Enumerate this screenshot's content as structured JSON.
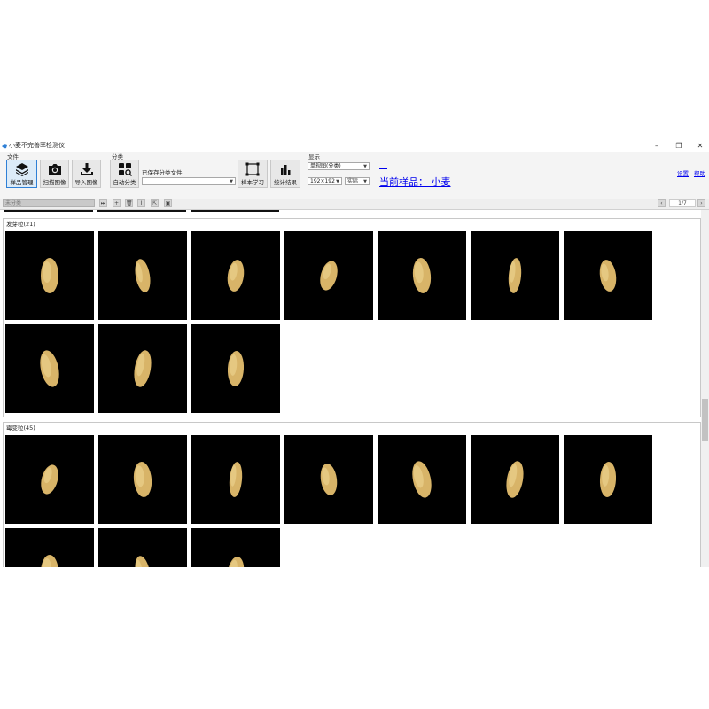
{
  "window": {
    "title": "小麦不完善率检测仪",
    "logo_icon": "app-logo-icon",
    "minimize": "–",
    "restore": "❐",
    "close": "✕"
  },
  "ribbon": {
    "file_group": "文件",
    "sample_manage": "样品管理",
    "scan_image": "扫描图像",
    "import_image": "导入图像",
    "classify_group": "分类",
    "auto_classify": "自动分类",
    "saved_files_label": "已保存分类文件",
    "saved_files_value": "",
    "sample_learning": "样本学习",
    "stats_result": "统计结果",
    "display_group": "显示",
    "view_mode": "单视图(分类)",
    "size": "192×192",
    "scale": "实际",
    "current_sample": "当前样品： 小麦",
    "settings": "设置",
    "help": "帮助"
  },
  "toolbar": {
    "category_placeholder": "未分类",
    "page": "1/7",
    "prev": "‹",
    "next": "›"
  },
  "groups": [
    {
      "title": "发芽粒(21)",
      "count": 10
    },
    {
      "title": "霉变粒(45)",
      "count": 10
    }
  ],
  "colors": {
    "accent": "#2f80d6",
    "link": "#0000ee",
    "grain": "#d8b468"
  }
}
